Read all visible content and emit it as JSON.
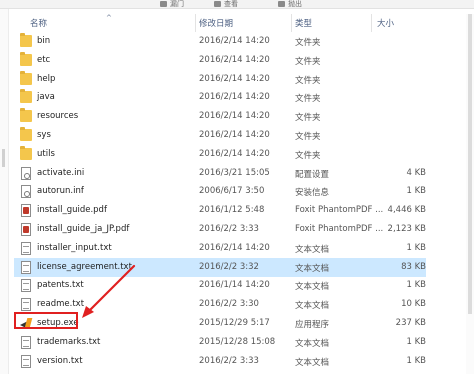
{
  "toolbar_partial": [
    {
      "label": "漏门",
      "icon": "pin-icon"
    },
    {
      "label": "查看",
      "icon": "view-icon"
    },
    {
      "label": "抛出",
      "icon": "share-icon"
    }
  ],
  "columns": {
    "name": "名称",
    "modified": "修改日期",
    "type": "类型",
    "size": "大小"
  },
  "files": [
    {
      "name": "bin",
      "date": "2016/2/14 14:20",
      "type": "文件夹",
      "size": "",
      "icon": "folder-icon"
    },
    {
      "name": "etc",
      "date": "2016/2/14 14:20",
      "type": "文件夹",
      "size": "",
      "icon": "folder-icon"
    },
    {
      "name": "help",
      "date": "2016/2/14 14:20",
      "type": "文件夹",
      "size": "",
      "icon": "folder-icon"
    },
    {
      "name": "java",
      "date": "2016/2/14 14:20",
      "type": "文件夹",
      "size": "",
      "icon": "folder-icon"
    },
    {
      "name": "resources",
      "date": "2016/2/14 14:20",
      "type": "文件夹",
      "size": "",
      "icon": "folder-icon"
    },
    {
      "name": "sys",
      "date": "2016/2/14 14:20",
      "type": "文件夹",
      "size": "",
      "icon": "folder-icon"
    },
    {
      "name": "utils",
      "date": "2016/2/14 14:20",
      "type": "文件夹",
      "size": "",
      "icon": "folder-icon"
    },
    {
      "name": "activate.ini",
      "date": "2016/3/21 15:05",
      "type": "配置设置",
      "size": "4 KB",
      "icon": "settings-file-icon"
    },
    {
      "name": "autorun.inf",
      "date": "2006/6/17 3:50",
      "type": "安装信息",
      "size": "1 KB",
      "icon": "settings-file-icon"
    },
    {
      "name": "install_guide.pdf",
      "date": "2016/1/12 5:48",
      "type": "Foxit PhantomPDF ...",
      "size": "4,446 KB",
      "icon": "pdf-icon"
    },
    {
      "name": "install_guide_ja_JP.pdf",
      "date": "2016/2/2 3:33",
      "type": "Foxit PhantomPDF ...",
      "size": "2,123 KB",
      "icon": "pdf-icon"
    },
    {
      "name": "installer_input.txt",
      "date": "2016/2/14 14:20",
      "type": "文本文档",
      "size": "1 KB",
      "icon": "text-file-icon"
    },
    {
      "name": "license_agreement.txt",
      "date": "2016/2/2 3:32",
      "type": "文本文档",
      "size": "83 KB",
      "icon": "text-file-icon"
    },
    {
      "name": "patents.txt",
      "date": "2016/1/14 14:20",
      "type": "文本文档",
      "size": "1 KB",
      "icon": "text-file-icon"
    },
    {
      "name": "readme.txt",
      "date": "2016/2/2 3:30",
      "type": "文本文档",
      "size": "10 KB",
      "icon": "text-file-icon"
    },
    {
      "name": "setup.exe",
      "date": "2015/12/29 5:17",
      "type": "应用程序",
      "size": "237 KB",
      "icon": "setup-app-icon"
    },
    {
      "name": "trademarks.txt",
      "date": "2015/12/28 15:08",
      "type": "文本文档",
      "size": "1 KB",
      "icon": "text-file-icon"
    },
    {
      "name": "version.txt",
      "date": "2016/2/2 3:33",
      "type": "文本文档",
      "size": "1 KB",
      "icon": "text-file-icon"
    }
  ],
  "highlighted_row": "license_agreement.txt",
  "annotated_row": "setup.exe",
  "colors": {
    "highlight": "#cce8ff",
    "annotation": "#e02020",
    "folder": "#f4c64c"
  }
}
